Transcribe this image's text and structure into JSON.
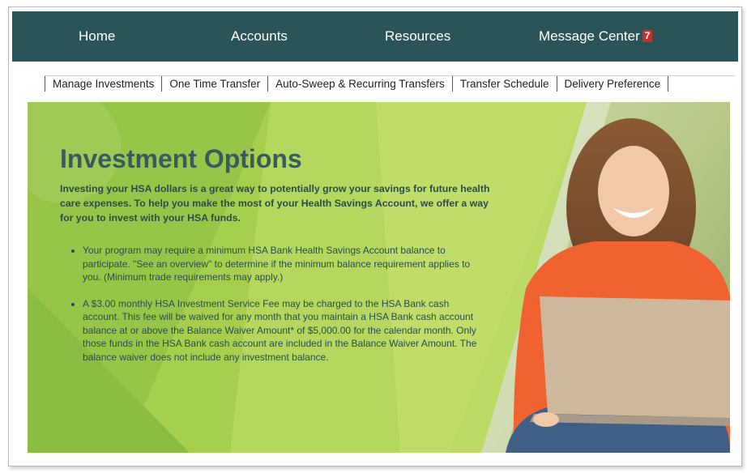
{
  "topnav": {
    "items": [
      {
        "label": "Home"
      },
      {
        "label": "Accounts"
      },
      {
        "label": "Resources"
      },
      {
        "label": "Message Center",
        "badge": "7"
      }
    ]
  },
  "subnav": {
    "items": [
      {
        "label": "Manage Investments"
      },
      {
        "label": "One Time Transfer"
      },
      {
        "label": "Auto-Sweep & Recurring Transfers"
      },
      {
        "label": "Transfer Schedule"
      },
      {
        "label": "Delivery Preference"
      }
    ]
  },
  "hero": {
    "title": "Investment Options",
    "intro": "Investing your HSA dollars is a great way to potentially grow your savings for future health care expenses. To help you make the most of your Health Savings Account, we offer a way for you to invest with your HSA funds.",
    "bullets": [
      "Your program may require a minimum HSA Bank Health Savings Account balance to participate. \"See an overview\" to determine if the minimum balance requirement applies to you. (Minimum trade requirements may apply.)",
      "A $3.00 monthly HSA Investment Service Fee may be charged to the HSA Bank cash account. This fee will be waived for any month that you maintain a HSA Bank cash account balance at or above the Balance Waiver Amount* of $5,000.00 for the calendar month. Only those funds in the HSA Bank cash account are included in the Balance Waiver Amount. The balance waiver does not include any investment balance."
    ]
  },
  "colors": {
    "nav_bg": "#2b5458",
    "badge_bg": "#c9302c",
    "title_text": "#3a5a5c",
    "hero_green": "#a6cf4e"
  }
}
